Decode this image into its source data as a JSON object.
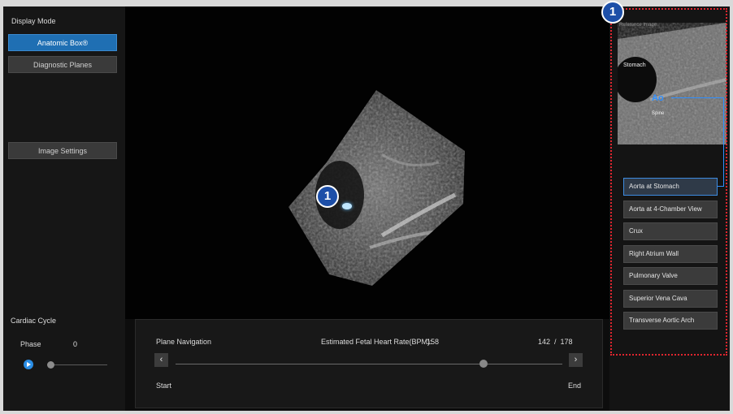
{
  "left_panel": {
    "display_mode_label": "Display Mode",
    "anatomic_box_label": "Anatomic Box®",
    "diagnostic_planes_label": "Diagnostic Planes",
    "image_settings_label": "Image Settings",
    "cardiac_cycle_label": "Cardiac Cycle",
    "phase_label": "Phase",
    "phase_value": "0"
  },
  "viewer": {
    "callout_number": "1"
  },
  "navigation": {
    "title": "Plane Navigation",
    "heart_rate_label_blue": "Estimated Fetal Heart Rate",
    "heart_rate_label_suffix": "(BPM):",
    "heart_rate_value": "158",
    "frame_position": "142  /  178",
    "prev_arrow": "‹",
    "next_arrow": "›",
    "start_label": "Start",
    "end_label": "End"
  },
  "right_panel": {
    "callout_number": "1",
    "reference_title": "Reference Image",
    "ref_label_stomach": "Stomach",
    "ref_label_ao": "Ao",
    "ref_label_spine": "Spine",
    "planes": [
      "Aorta at Stomach",
      "Aorta at 4-Chamber View",
      "Crux",
      "Right Atrium Wall",
      "Pulmonary Valve",
      "Superior Vena Cava",
      "Transverse Aortic Arch"
    ],
    "selected_plane_index": 0
  },
  "colors": {
    "accent_blue": "#1f6fb3",
    "highlight_blue": "#3d9ce8",
    "callout_dash_red": "#e0252e"
  }
}
